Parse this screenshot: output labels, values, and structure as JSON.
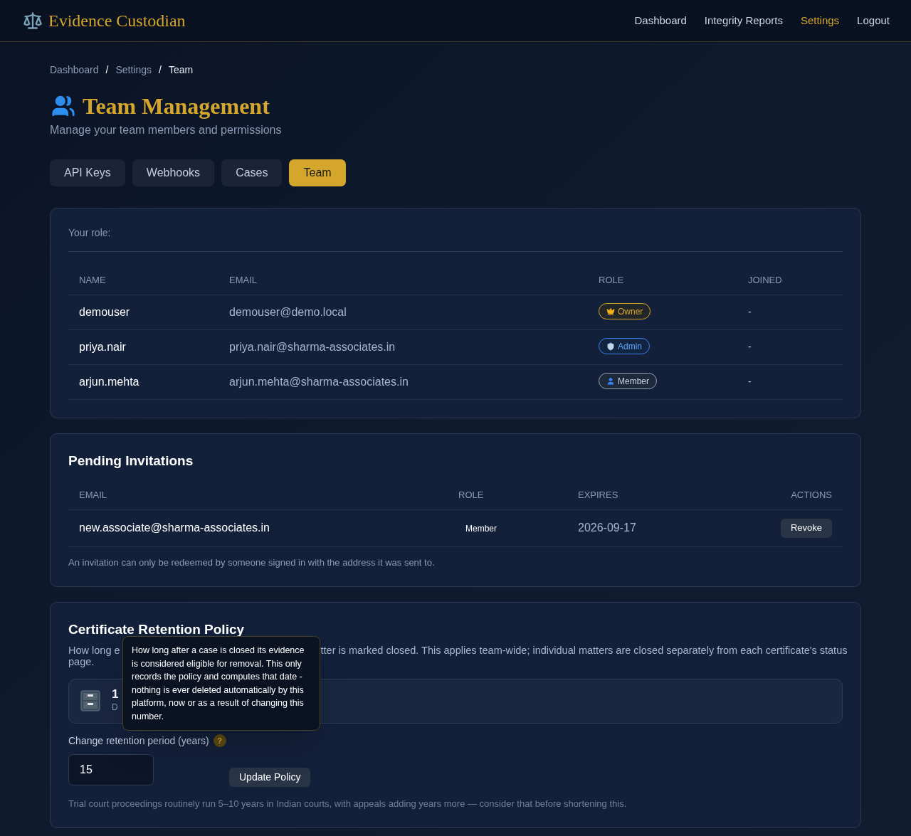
{
  "brand": "Evidence Custodian",
  "nav": [
    {
      "label": "Dashboard",
      "selected": false
    },
    {
      "label": "Integrity Reports",
      "selected": false
    },
    {
      "label": "Settings",
      "selected": true
    },
    {
      "label": "Logout",
      "selected": false
    }
  ],
  "breadcrumb": [
    {
      "kind": "link",
      "label": "Dashboard"
    },
    {
      "kind": "separator",
      "label": "/"
    },
    {
      "kind": "link",
      "label": "Settings"
    },
    {
      "kind": "separator",
      "label": "/"
    },
    {
      "kind": "current",
      "label": "Team"
    }
  ],
  "title": "Team Management",
  "subtitle": "Manage your team members and permissions",
  "tabs": [
    {
      "label": "API Keys",
      "selected": false
    },
    {
      "label": "Webhooks",
      "selected": false
    },
    {
      "label": "Cases",
      "selected": false
    },
    {
      "label": "Team",
      "selected": true
    }
  ],
  "members": {
    "your_role_label": "Your role:",
    "columns": [
      "NAME",
      "EMAIL",
      "ROLE",
      "JOINED"
    ],
    "rows": [
      {
        "name": "demouser",
        "email": "demouser@demo.local",
        "role": {
          "kind": "owner",
          "label": "Owner"
        },
        "joined": "-"
      },
      {
        "name": "priya.nair",
        "email": "priya.nair@sharma-associates.in",
        "role": {
          "kind": "admin",
          "label": "Admin"
        },
        "joined": "-"
      },
      {
        "name": "arjun.mehta",
        "email": "arjun.mehta@sharma-associates.in",
        "role": {
          "kind": "member",
          "label": "Member"
        },
        "joined": "-"
      }
    ]
  },
  "invitations": {
    "title": "Pending Invitations",
    "columns": [
      "EMAIL",
      "ROLE",
      "EXPIRES",
      "ACTIONS"
    ],
    "rows": [
      {
        "email": "new.associate@sharma-associates.in",
        "role": "Member",
        "expires": "2026-09-17",
        "action": "Revoke"
      }
    ],
    "note": "An invitation can only be redeemed by someone signed in with the address it was sent to."
  },
  "retention": {
    "title": "Certificate Retention Policy",
    "description": [
      "How long e",
      "tter is marked closed. This applies team-wide; individual matters are closed separately from each certificate's status",
      "page."
    ],
    "stat_value": "1",
    "stat_label": "D",
    "field_label": "Change retention period (years)",
    "help": "?",
    "value": "15",
    "button": "Update Policy",
    "note": "Trial court proceedings routinely run 5–10 years in Indian courts, with appeals adding years more — consider that before shortening this.",
    "tooltip": "How long after a case is closed its evidence is considered eligible for removal. This only records the policy and computes that date - nothing is ever deleted automatically by this platform, now or as a result of changing this number."
  }
}
